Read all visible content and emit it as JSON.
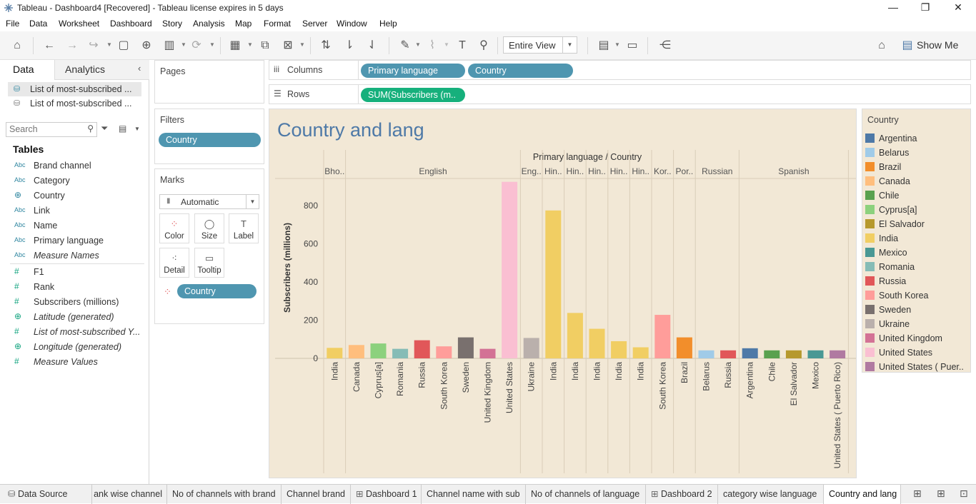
{
  "window": {
    "title": "Tableau - Dashboard4 [Recovered] - Tableau license expires in 5 days",
    "minimize": "—",
    "restore": "❐",
    "close": "✕"
  },
  "menu": [
    "File",
    "Data",
    "Worksheet",
    "Dashboard",
    "Story",
    "Analysis",
    "Map",
    "Format",
    "Server",
    "Window",
    "Help"
  ],
  "toolbar": {
    "view_select": "Entire View",
    "show_me": "Show Me"
  },
  "data_pane": {
    "tab_data": "Data",
    "tab_analytics": "Analytics",
    "sources": [
      "List of most-subscribed ...",
      "List of most-subscribed ..."
    ],
    "search_placeholder": "Search",
    "tables_heading": "Tables",
    "dimensions": [
      {
        "type": "Abc",
        "name": "Brand channel"
      },
      {
        "type": "Abc",
        "name": "Category"
      },
      {
        "type": "geo",
        "name": "Country"
      },
      {
        "type": "Abc",
        "name": "Link"
      },
      {
        "type": "Abc",
        "name": "Name"
      },
      {
        "type": "Abc",
        "name": "Primary language"
      },
      {
        "type": "Abc",
        "name": "Measure Names",
        "italic": true
      }
    ],
    "measures": [
      {
        "type": "#",
        "name": "F1"
      },
      {
        "type": "#",
        "name": "Rank"
      },
      {
        "type": "#",
        "name": "Subscribers (millions)"
      },
      {
        "type": "geo",
        "name": "Latitude (generated)",
        "italic": true
      },
      {
        "type": "#",
        "name": "List of most-subscribed Y...",
        "italic": true
      },
      {
        "type": "geo",
        "name": "Longitude (generated)",
        "italic": true
      },
      {
        "type": "#",
        "name": "Measure Values",
        "italic": true
      }
    ]
  },
  "cards": {
    "pages": "Pages",
    "filters": "Filters",
    "filter_pill": "Country",
    "marks": "Marks",
    "mark_type": "Automatic",
    "mark_buttons": [
      "Color",
      "Size",
      "Label",
      "Detail",
      "Tooltip"
    ],
    "marks_pill": "Country"
  },
  "shelves": {
    "columns_label": "Columns",
    "rows_label": "Rows",
    "columns_pills": [
      "Primary language",
      "Country"
    ],
    "rows_pill": "SUM(Subscribers (m.."
  },
  "view": {
    "title": "Country and lang"
  },
  "legend": {
    "title": "Country",
    "items": [
      {
        "name": "Argentina",
        "color": "#4e79a7"
      },
      {
        "name": "Belarus",
        "color": "#a0cbe8"
      },
      {
        "name": "Brazil",
        "color": "#f28e2b"
      },
      {
        "name": "Canada",
        "color": "#ffbe7d"
      },
      {
        "name": "Chile",
        "color": "#59a14f"
      },
      {
        "name": "Cyprus[a]",
        "color": "#8cd17d"
      },
      {
        "name": "El Salvador",
        "color": "#b6992d"
      },
      {
        "name": "India",
        "color": "#f1ce63"
      },
      {
        "name": "Mexico",
        "color": "#499894"
      },
      {
        "name": "Romania",
        "color": "#86bcb6"
      },
      {
        "name": "Russia",
        "color": "#e15759"
      },
      {
        "name": "South Korea",
        "color": "#ff9d9a"
      },
      {
        "name": "Sweden",
        "color": "#79706e"
      },
      {
        "name": "Ukraine",
        "color": "#bab0ac"
      },
      {
        "name": "United Kingdom",
        "color": "#d37295"
      },
      {
        "name": "United States",
        "color": "#fabfd2"
      },
      {
        "name": "United States ( Puer..",
        "color": "#b07aa1"
      }
    ]
  },
  "chart_data": {
    "type": "bar",
    "title": "Country and lang",
    "header_title": "Primary language / Country",
    "ylabel": "Subscribers (millions)",
    "ylim": [
      0,
      950
    ],
    "yticks": [
      0,
      200,
      400,
      600,
      800
    ],
    "groups": [
      {
        "label": "Bho..",
        "bars": [
          {
            "country": "India",
            "value": 55
          }
        ]
      },
      {
        "label": "English",
        "bars": [
          {
            "country": "Canada",
            "value": 70
          },
          {
            "country": "Cyprus[a]",
            "value": 78
          },
          {
            "country": "Romania",
            "value": 50
          },
          {
            "country": "Russia",
            "value": 95
          },
          {
            "country": "South Korea",
            "value": 63
          },
          {
            "country": "Sweden",
            "value": 110
          },
          {
            "country": "United Kingdom",
            "value": 50
          },
          {
            "country": "United States",
            "value": 925
          }
        ]
      },
      {
        "label": "Eng..",
        "bars": [
          {
            "country": "Ukraine",
            "value": 107
          }
        ]
      },
      {
        "label": "Hin..",
        "bars": [
          {
            "country": "India",
            "value": 775
          }
        ]
      },
      {
        "label": "Hin..",
        "bars": [
          {
            "country": "India",
            "value": 238
          }
        ]
      },
      {
        "label": "Hin..",
        "bars": [
          {
            "country": "India",
            "value": 155
          }
        ]
      },
      {
        "label": "Hin..",
        "bars": [
          {
            "country": "India",
            "value": 90
          }
        ]
      },
      {
        "label": "Hin..",
        "bars": [
          {
            "country": "India",
            "value": 58
          }
        ]
      },
      {
        "label": "Kor..",
        "bars": [
          {
            "country": "South Korea",
            "value": 228
          }
        ]
      },
      {
        "label": "Por..",
        "bars": [
          {
            "country": "Brazil",
            "value": 110
          }
        ]
      },
      {
        "label": "Russian",
        "bars": [
          {
            "country": "Belarus",
            "value": 42
          },
          {
            "country": "Russia",
            "value": 42
          }
        ]
      },
      {
        "label": "Spanish",
        "bars": [
          {
            "country": "Argentina",
            "value": 53
          },
          {
            "country": "Chile",
            "value": 42
          },
          {
            "country": "El Salvador",
            "value": 42
          },
          {
            "country": "Mexico",
            "value": 42
          },
          {
            "country": "United States ( Puerto Rico)",
            "value": 42
          }
        ]
      }
    ]
  },
  "sheet_tabs": [
    {
      "label": "Data Source",
      "icon": true
    },
    {
      "label": "ank wise channel"
    },
    {
      "label": "No of channels with brand"
    },
    {
      "label": "Channel brand"
    },
    {
      "label": "Dashboard 1",
      "icon": true
    },
    {
      "label": "Channel name with sub"
    },
    {
      "label": "No of channels of language"
    },
    {
      "label": "Dashboard 2",
      "icon": true
    },
    {
      "label": "category wise language"
    },
    {
      "label": "Country and lang",
      "active": true
    }
  ]
}
